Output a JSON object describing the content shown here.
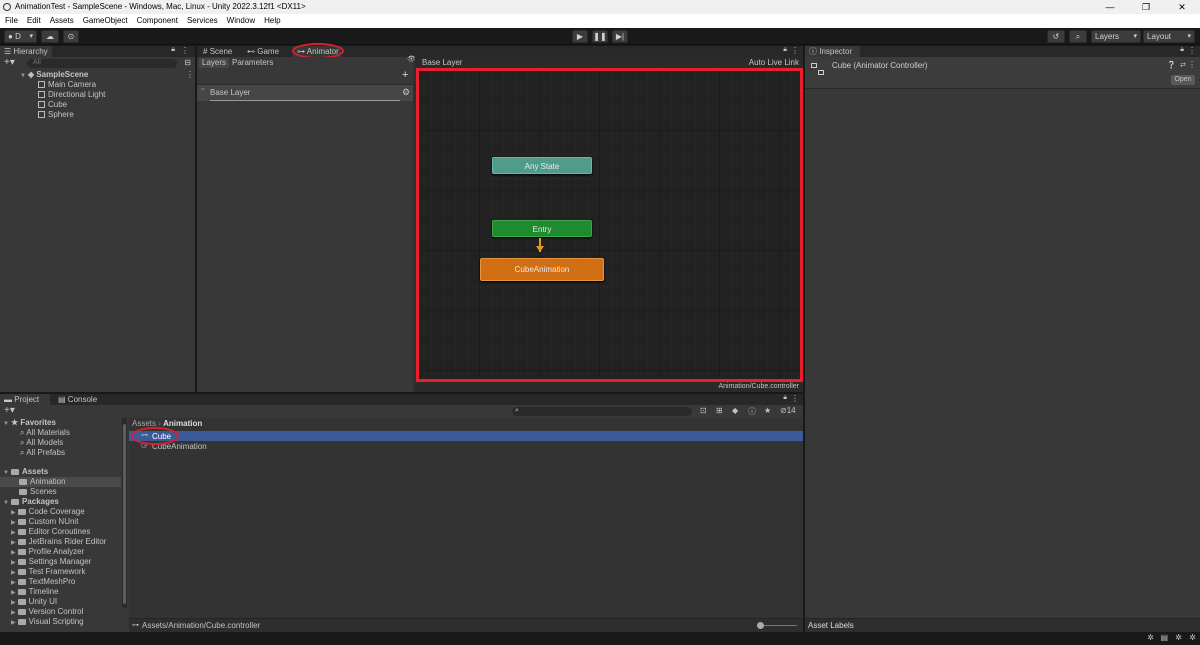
{
  "window": {
    "title": "AnimationTest - SampleScene - Windows, Mac, Linux - Unity 2022.3.12f1 <DX11>",
    "buttons": [
      "—",
      "❐",
      "✕"
    ]
  },
  "menu": [
    "File",
    "Edit",
    "Assets",
    "GameObject",
    "Component",
    "Services",
    "Window",
    "Help"
  ],
  "toolbar": {
    "account": "D",
    "layers": "Layers",
    "layout": "Layout",
    "play_icon": "play-icon",
    "pause_icon": "pause-icon",
    "step_icon": "step-icon"
  },
  "hierarchy": {
    "tab": "Hierarchy",
    "search_placeholder": "All",
    "scene": "SampleScene",
    "items": [
      "Main Camera",
      "Directional Light",
      "Cube",
      "Sphere"
    ]
  },
  "center_tabs": [
    "Scene",
    "Game",
    "Animator"
  ],
  "animator": {
    "subtabs": [
      "Layers",
      "Parameters"
    ],
    "breadcrumb": "Base Layer",
    "auto_live_link": "Auto Live Link",
    "layer_name": "Base Layer",
    "nodes": {
      "any_state": "Any State",
      "entry": "Entry",
      "default_state": "CubeAnimation"
    },
    "footer_path": "Animation/Cube.controller",
    "colors": {
      "any_state": "#4f9c8c",
      "entry": "#1f8a2e",
      "default_state": "#d16f14",
      "highlight": "#e8202e"
    }
  },
  "inspector": {
    "tab": "Inspector",
    "title": "Cube (Animator Controller)",
    "open_button": "Open",
    "asset_labels": "Asset Labels"
  },
  "project": {
    "tabs": [
      "Project",
      "Console"
    ],
    "favorites": {
      "label": "Favorites",
      "items": [
        "All Materials",
        "All Models",
        "All Prefabs"
      ]
    },
    "assets": {
      "label": "Assets",
      "items": [
        "Animation",
        "Scenes"
      ]
    },
    "packages": {
      "label": "Packages",
      "items": [
        "Code Coverage",
        "Custom NUnit",
        "Editor Coroutines",
        "JetBrains Rider Editor",
        "Profile Analyzer",
        "Settings Manager",
        "Test Framework",
        "TextMeshPro",
        "Timeline",
        "Unity UI",
        "Version Control",
        "Visual Scripting"
      ]
    },
    "breadcrumb": [
      "Assets",
      "Animation"
    ],
    "files": [
      {
        "name": "Cube",
        "selected": true
      },
      {
        "name": "CubeAnimation",
        "selected": false
      }
    ],
    "hidden_count": "14",
    "footer_path": "Assets/Animation/Cube.controller"
  }
}
